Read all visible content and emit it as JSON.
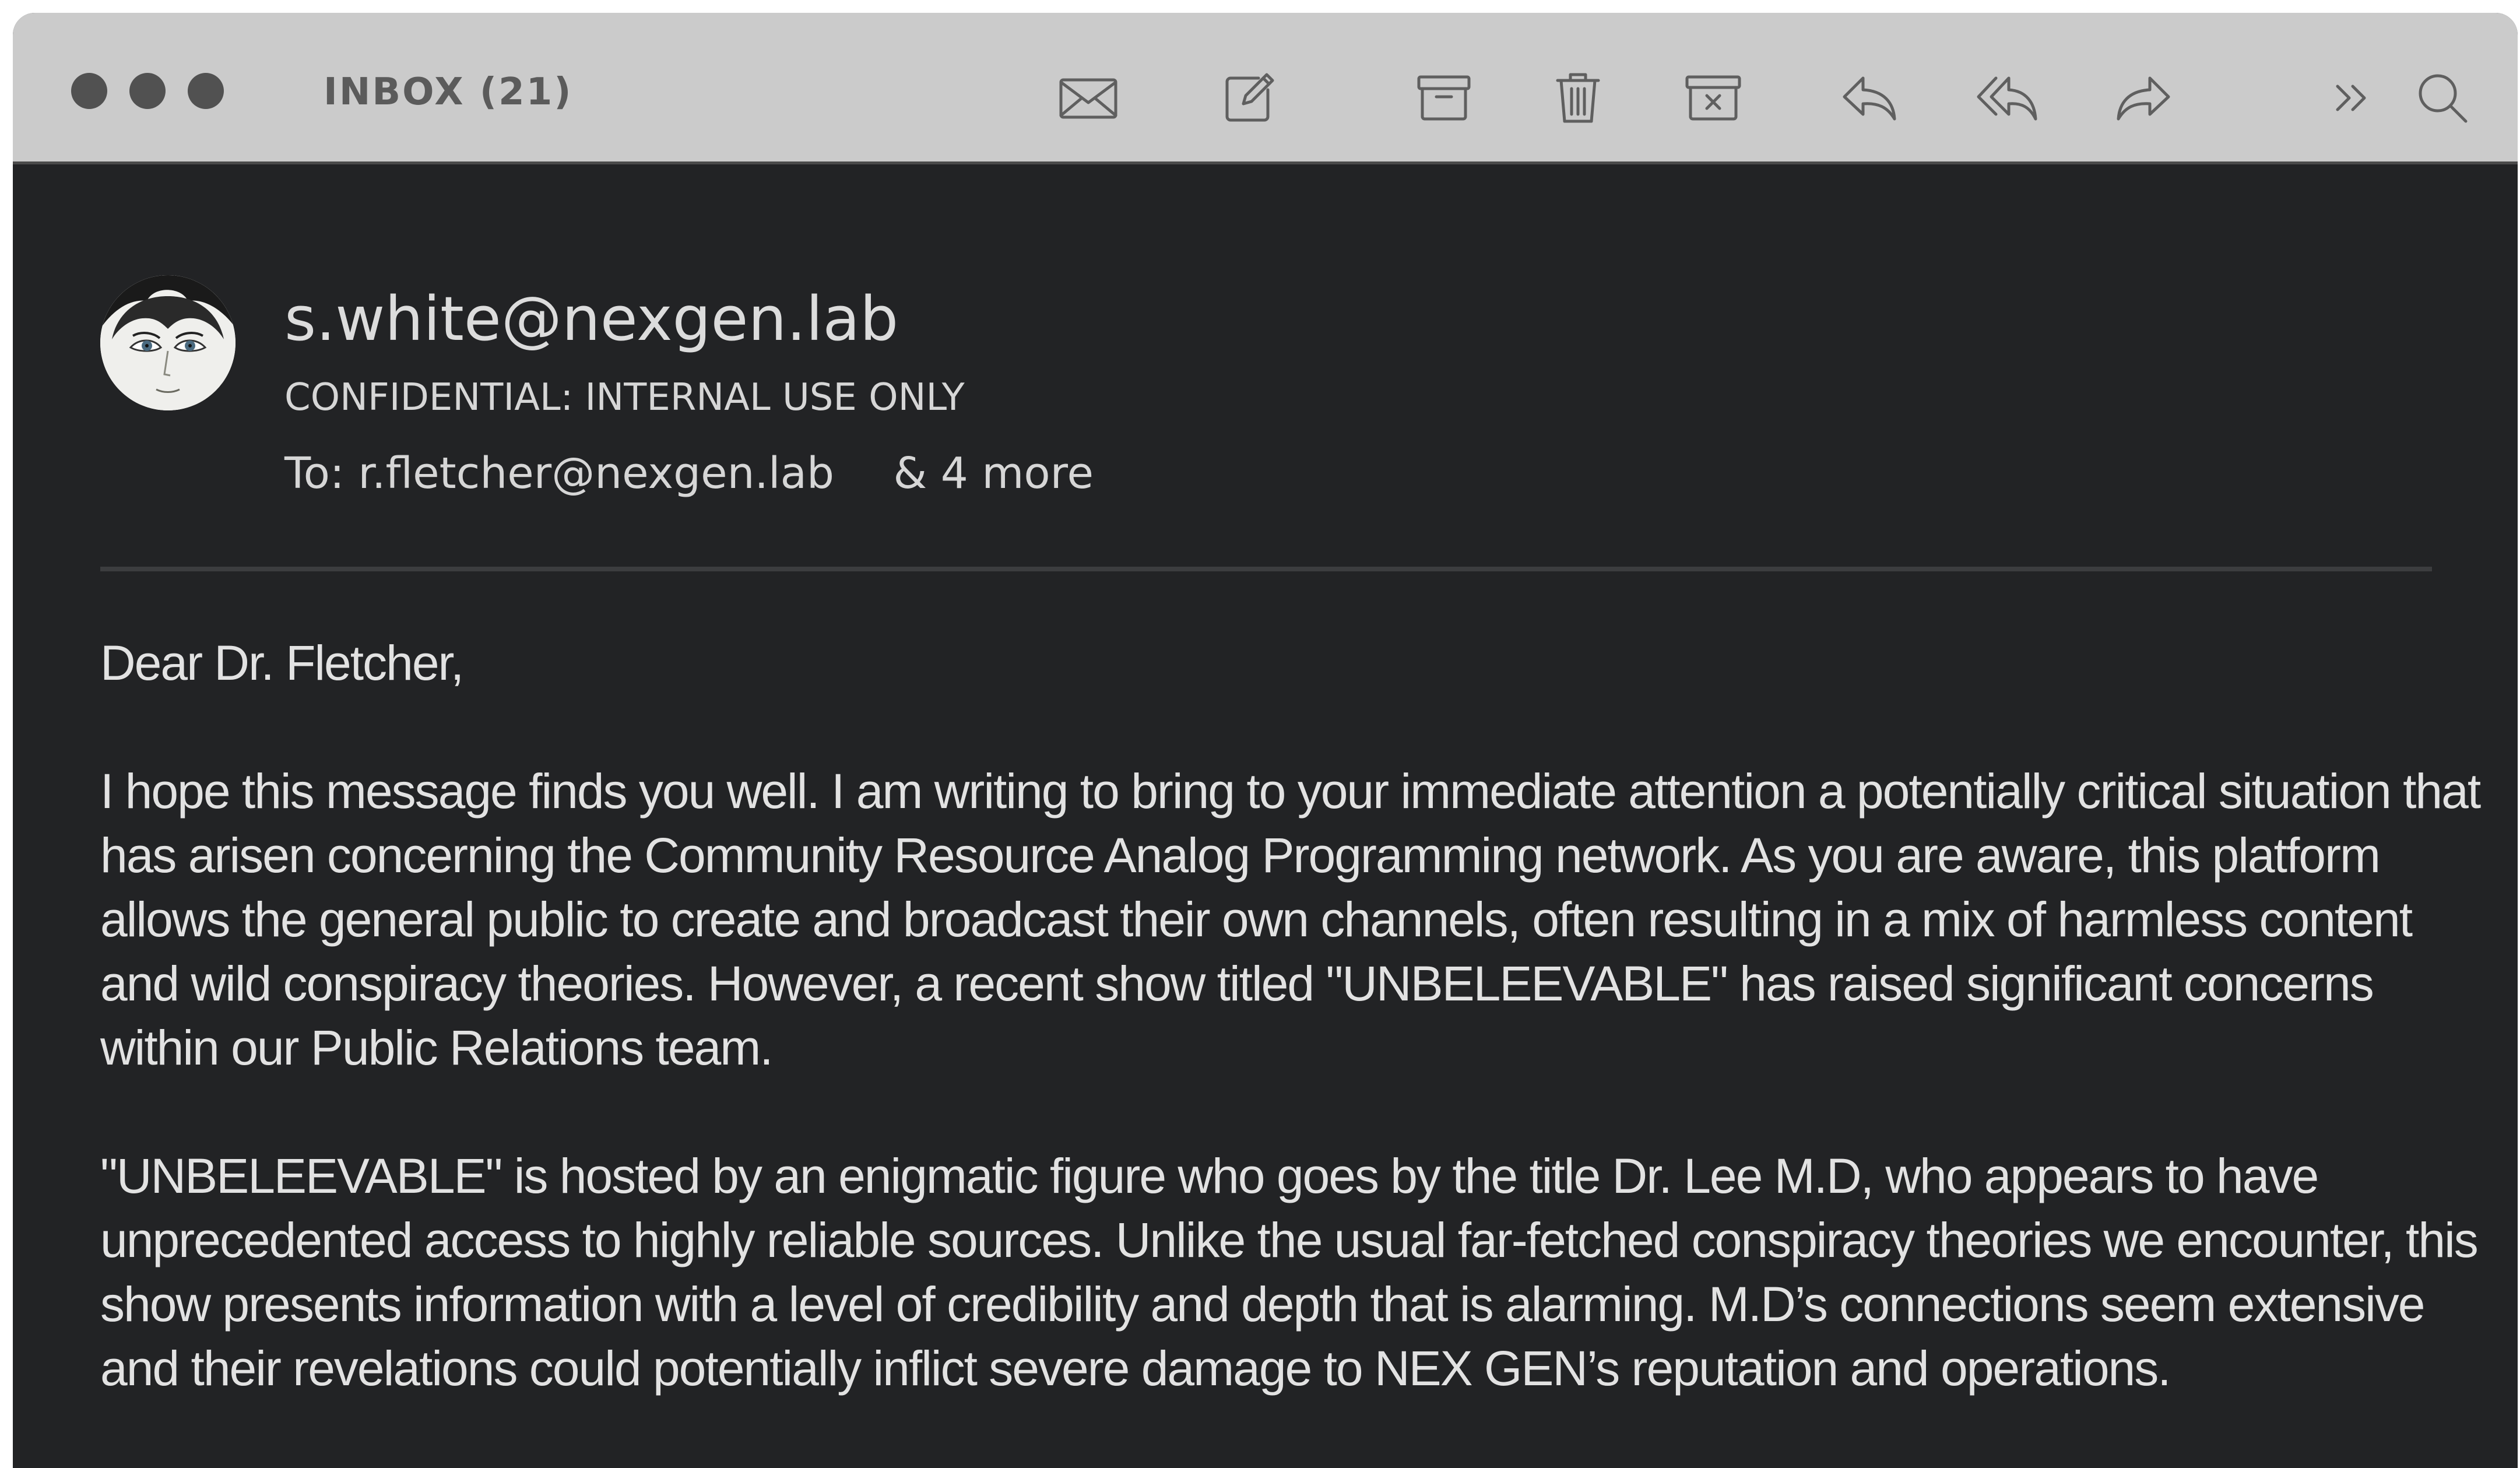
{
  "window": {
    "title": "INBOX (21)"
  },
  "toolbar": {
    "icons": [
      "envelope-icon",
      "compose-icon",
      "archive-icon",
      "trash-icon",
      "junk-icon",
      "reply-icon",
      "reply-all-icon",
      "forward-icon",
      "more-chevron-icon",
      "search-icon"
    ]
  },
  "message": {
    "sender": "s.white@nexgen.lab",
    "subject": "CONFIDENTIAL: INTERNAL USE ONLY",
    "to_prefix": "To:",
    "to_address": "r.fletcher@nexgen.lab",
    "more_recipients": "& 4 more",
    "greeting": "Dear Dr. Fletcher,",
    "paragraphs": [
      "I hope this message finds you well. I am writing to bring to your immediate attention a potentially critical situation that has arisen concerning the Community Resource Analog Programming network. As you are aware, this platform allows the general public to create and broadcast their own channels, often resulting in a mix of harmless content and wild conspiracy theories. However, a recent show titled \"UNBELEEVABLE\" has raised significant concerns within our Public Relations team.",
      "\"UNBELEEVABLE\" is hosted by an enigmatic figure who goes by the title Dr. Lee M.D, who appears to have unprecedented access to highly reliable sources. Unlike the usual far-fetched conspiracy theories we encounter, this show presents information with a level of credibility and depth that is alarming. M.D’s connections seem extensive and their revelations could potentially inflict severe damage to NEX GEN’s reputation and operations."
    ]
  },
  "colors": {
    "titlebar": "#cbcbcb",
    "window_bg": "#222325",
    "text": "#e2e2e2",
    "icon": "#5f5f5f"
  }
}
